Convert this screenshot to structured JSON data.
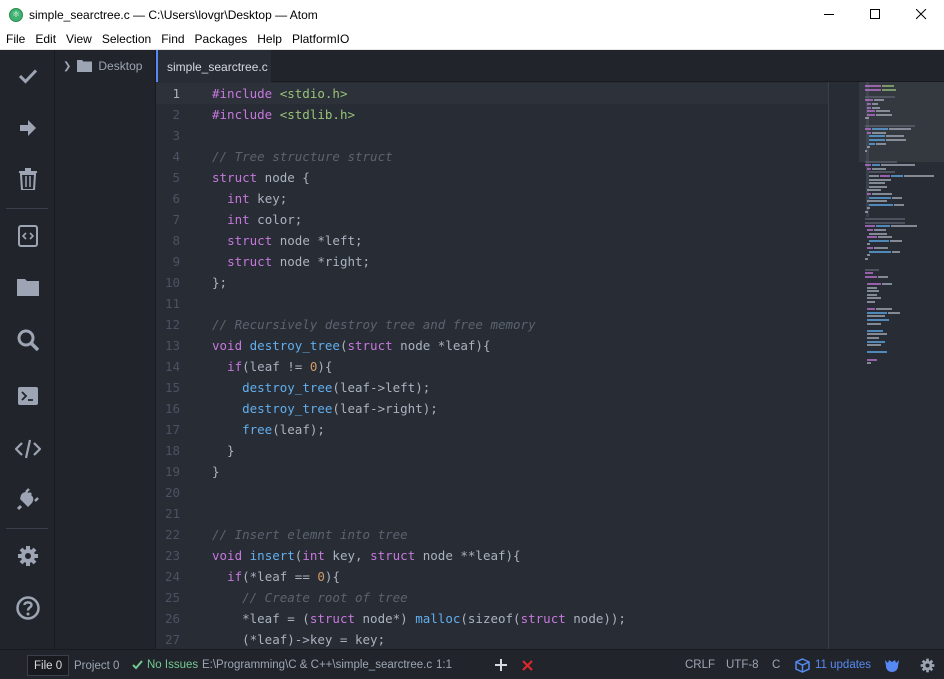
{
  "window": {
    "title": "simple_searctree.c — C:\\Users\\lovgr\\Desktop — Atom",
    "app_icon": "atom-icon"
  },
  "menu": [
    "File",
    "Edit",
    "View",
    "Selection",
    "Find",
    "Packages",
    "Help",
    "PlatformIO"
  ],
  "actionbar": {
    "items": [
      "build-check-icon",
      "upload-arrow-icon",
      "trash-clean-icon",
      "new-project-icon",
      "open-folder-icon",
      "search-icon",
      "terminal-icon",
      "code-tags-icon",
      "plug-icon",
      "settings-gear-icon",
      "help-icon"
    ]
  },
  "tree": {
    "root_label": "Desktop"
  },
  "tabs": [
    {
      "label": "simple_searctree.c",
      "active": true
    }
  ],
  "editor": {
    "current_line": 1,
    "lines": [
      [
        [
          "#include ",
          "#c678dd"
        ],
        [
          "<stdio.h>",
          "#98c379"
        ]
      ],
      [
        [
          "#include ",
          "#c678dd"
        ],
        [
          "<stdlib.h>",
          "#98c379"
        ]
      ],
      [],
      [
        [
          "// Tree structure struct",
          "#5c6370",
          "i"
        ]
      ],
      [
        [
          "struct",
          "#c678dd"
        ],
        [
          " node {",
          "#abb2bf"
        ]
      ],
      [
        [
          "  ",
          "#abb2bf"
        ],
        [
          "int",
          "#c678dd"
        ],
        [
          " key;",
          "#abb2bf"
        ]
      ],
      [
        [
          "  ",
          "#abb2bf"
        ],
        [
          "int",
          "#c678dd"
        ],
        [
          " color;",
          "#abb2bf"
        ]
      ],
      [
        [
          "  ",
          "#abb2bf"
        ],
        [
          "struct",
          "#c678dd"
        ],
        [
          " node *left;",
          "#abb2bf"
        ]
      ],
      [
        [
          "  ",
          "#abb2bf"
        ],
        [
          "struct",
          "#c678dd"
        ],
        [
          " node *right;",
          "#abb2bf"
        ]
      ],
      [
        [
          "};",
          "#abb2bf"
        ]
      ],
      [],
      [
        [
          "// Recursively destroy tree and free memory",
          "#5c6370",
          "i"
        ]
      ],
      [
        [
          "void",
          "#c678dd"
        ],
        [
          " ",
          "#abb2bf"
        ],
        [
          "destroy_tree",
          "#61afef"
        ],
        [
          "(",
          "#abb2bf"
        ],
        [
          "struct",
          "#c678dd"
        ],
        [
          " node *leaf){",
          "#abb2bf"
        ]
      ],
      [
        [
          "  ",
          "#abb2bf"
        ],
        [
          "if",
          "#c678dd"
        ],
        [
          "(leaf != ",
          "#abb2bf"
        ],
        [
          "0",
          "#d19a66"
        ],
        [
          "){",
          "#abb2bf"
        ]
      ],
      [
        [
          "    ",
          "#abb2bf"
        ],
        [
          "destroy_tree",
          "#61afef"
        ],
        [
          "(leaf->left);",
          "#abb2bf"
        ]
      ],
      [
        [
          "    ",
          "#abb2bf"
        ],
        [
          "destroy_tree",
          "#61afef"
        ],
        [
          "(leaf->right);",
          "#abb2bf"
        ]
      ],
      [
        [
          "    ",
          "#abb2bf"
        ],
        [
          "free",
          "#61afef"
        ],
        [
          "(leaf);",
          "#abb2bf"
        ]
      ],
      [
        [
          "  }",
          "#abb2bf"
        ]
      ],
      [
        [
          "}",
          "#abb2bf"
        ]
      ],
      [],
      [],
      [
        [
          "// Insert elemnt into tree",
          "#5c6370",
          "i"
        ]
      ],
      [
        [
          "void",
          "#c678dd"
        ],
        [
          " ",
          "#abb2bf"
        ],
        [
          "insert",
          "#61afef"
        ],
        [
          "(",
          "#abb2bf"
        ],
        [
          "int",
          "#c678dd"
        ],
        [
          " key, ",
          "#abb2bf"
        ],
        [
          "struct",
          "#c678dd"
        ],
        [
          " node **leaf){",
          "#abb2bf"
        ]
      ],
      [
        [
          "  ",
          "#abb2bf"
        ],
        [
          "if",
          "#c678dd"
        ],
        [
          "(*leaf == ",
          "#abb2bf"
        ],
        [
          "0",
          "#d19a66"
        ],
        [
          "){",
          "#abb2bf"
        ]
      ],
      [
        [
          "    ",
          "#abb2bf"
        ],
        [
          "// Create root of tree",
          "#5c6370",
          "i"
        ]
      ],
      [
        [
          "    *leaf = (",
          "#abb2bf"
        ],
        [
          "struct",
          "#c678dd"
        ],
        [
          " node*) ",
          "#abb2bf"
        ],
        [
          "malloc",
          "#61afef"
        ],
        [
          "(sizeof(",
          "#abb2bf"
        ],
        [
          "struct",
          "#c678dd"
        ],
        [
          " node));",
          "#abb2bf"
        ]
      ],
      [
        [
          "    (*leaf)->key = key;",
          "#abb2bf"
        ]
      ]
    ]
  },
  "statusbar": {
    "file_tab": "File 0",
    "project_tab": "Project 0",
    "issues": "No Issues",
    "path": "E:\\Programming\\C & C++\\simple_searctree.c",
    "cursor": "1:1",
    "line_ending": "CRLF",
    "encoding": "UTF-8",
    "grammar": "C",
    "updates": "11 updates",
    "colors": {
      "ok": "#73c990",
      "error": "#e0282b",
      "updates": "#568af2"
    }
  }
}
